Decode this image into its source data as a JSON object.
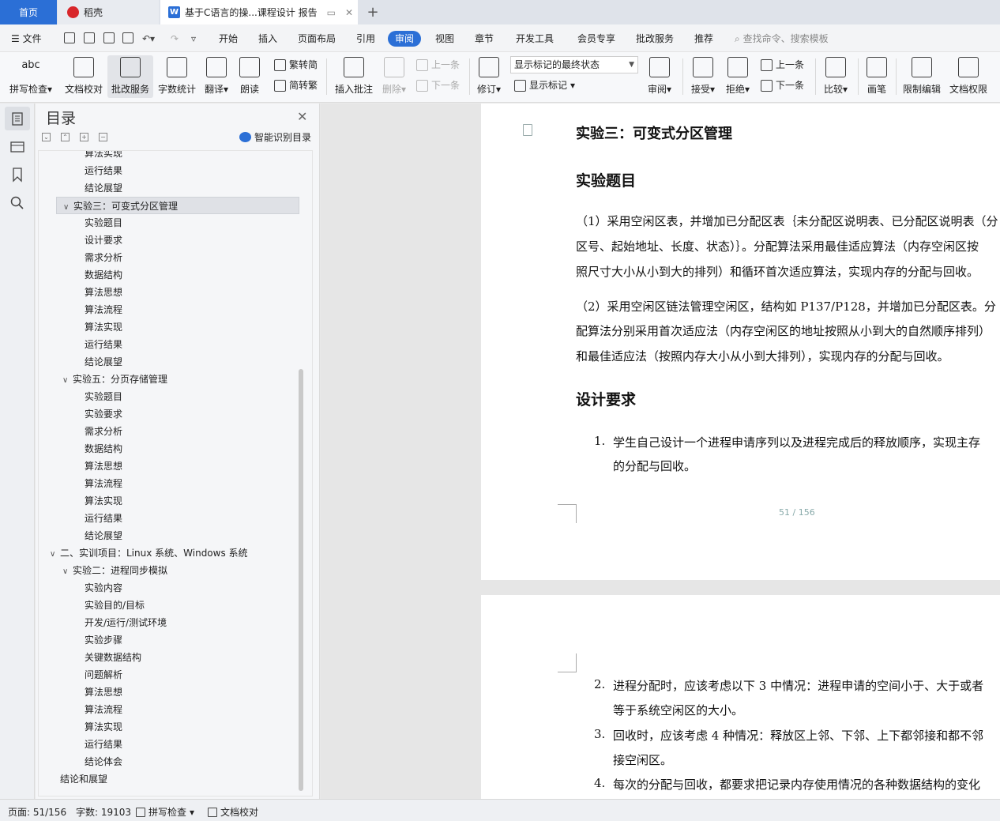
{
  "tabs": {
    "home": "首页",
    "daoke": "稻壳",
    "doc": "基于C语言的操...课程设计 报告",
    "add": "+"
  },
  "menu": {
    "file": "文件",
    "items": [
      "开始",
      "插入",
      "页面布局",
      "引用",
      "审阅",
      "视图",
      "章节",
      "开发工具",
      "会员专享",
      "批改服务",
      "推荐"
    ],
    "active": "审阅",
    "search_placeholder": "查找命令、搜索模板"
  },
  "ribbon": {
    "spellcheck": "拼写检查",
    "doc_proof": "文档校对",
    "correction_service": "批改服务",
    "word_count": "字数统计",
    "translate": "翻译",
    "read_aloud": "朗读",
    "trad_simp": "繁转简",
    "simp_trad": "简转繁",
    "insert_comment": "插入批注",
    "delete": "删除",
    "prev_comment": "上一条",
    "next_comment": "下一条",
    "track_changes": "修订",
    "markup_select": "显示标记的最终状态",
    "show_markup": "显示标记",
    "review": "审阅",
    "accept": "接受",
    "reject": "拒绝",
    "prev_change": "上一条",
    "next_change": "下一条",
    "compare": "比较",
    "pen": "画笔",
    "restrict_edit": "限制编辑",
    "doc_permission": "文档权限"
  },
  "toc": {
    "title": "目录",
    "smart": "智能识别目录",
    "items": [
      {
        "label": "算法实现",
        "level": 3
      },
      {
        "label": "运行结果",
        "level": 3
      },
      {
        "label": "结论展望",
        "level": 3
      },
      {
        "label": "实验三：可变式分区管理",
        "level": 2,
        "expanded": true,
        "selected": true
      },
      {
        "label": "实验题目",
        "level": 3
      },
      {
        "label": "设计要求",
        "level": 3
      },
      {
        "label": "需求分析",
        "level": 3
      },
      {
        "label": "数据结构",
        "level": 3
      },
      {
        "label": "算法思想",
        "level": 3
      },
      {
        "label": "算法流程",
        "level": 3
      },
      {
        "label": "算法实现",
        "level": 3
      },
      {
        "label": "运行结果",
        "level": 3
      },
      {
        "label": "结论展望",
        "level": 3
      },
      {
        "label": "实验五：分页存储管理",
        "level": 2,
        "expanded": true
      },
      {
        "label": "实验题目",
        "level": 3
      },
      {
        "label": "实验要求",
        "level": 3
      },
      {
        "label": "需求分析",
        "level": 3
      },
      {
        "label": "数据结构",
        "level": 3
      },
      {
        "label": "算法思想",
        "level": 3
      },
      {
        "label": "算法流程",
        "level": 3
      },
      {
        "label": "算法实现",
        "level": 3
      },
      {
        "label": "运行结果",
        "level": 3
      },
      {
        "label": "结论展望",
        "level": 3
      },
      {
        "label": "二、实训项目：Linux 系统、Windows 系统",
        "level": 1,
        "expanded": true
      },
      {
        "label": "实验二：进程同步模拟",
        "level": 2,
        "expanded": true
      },
      {
        "label": "实验内容",
        "level": 3
      },
      {
        "label": "实验目的/目标",
        "level": 3
      },
      {
        "label": "开发/运行/测试环境",
        "level": 3
      },
      {
        "label": "实验步骤",
        "level": 3
      },
      {
        "label": "关键数据结构",
        "level": 3
      },
      {
        "label": "问题解析",
        "level": 3
      },
      {
        "label": "算法思想",
        "level": 3
      },
      {
        "label": "算法流程",
        "level": 3
      },
      {
        "label": "算法实现",
        "level": 3
      },
      {
        "label": "运行结果",
        "level": 3
      },
      {
        "label": "结论体会",
        "level": 3
      },
      {
        "label": "结论和展望",
        "level": 1
      }
    ]
  },
  "document": {
    "top_heading": "实验三：可变式分区管理",
    "section1": "实验题目",
    "p1_lines": [
      "（1）采用空闲区表，并增加已分配区表｛未分配区说明表、已分配区说明表（分",
      "区号、起始地址、长度、状态）｝。分配算法采用最佳适应算法（内存空闲区按",
      "照尺寸大小从小到大的排列）和循环首次适应算法，实现内存的分配与回收。"
    ],
    "p2_lines": [
      "（2）采用空闲区链法管理空闲区，结构如 P137/P128，并增加已分配区表。分",
      "配算法分别采用首次适应法（内存空闲区的地址按照从小到大的自然顺序排列）",
      "和最佳适应法（按照内存大小从小到大排列），实现内存的分配与回收。"
    ],
    "section2": "设计要求",
    "list1_num": "1.",
    "list1_lines": [
      "学生自己设计一个进程申请序列以及进程完成后的释放顺序，实现主存",
      "的分配与回收。"
    ],
    "page_num": "51 / 156",
    "list2_num": "2.",
    "list2_lines": [
      "进程分配时，应该考虑以下 3 中情况：进程申请的空间小于、大于或者",
      "等于系统空闲区的大小。"
    ],
    "list3_num": "3.",
    "list3_lines": [
      "回收时，应该考虑 4 种情况：释放区上邻、下邻、上下都邻接和都不邻",
      "接空闲区。"
    ],
    "list4_num": "4.",
    "list4_lines": [
      "每次的分配与回收，都要求把记录内存使用情况的各种数据结构的变化"
    ]
  },
  "status": {
    "page": "页面: 51/156",
    "words": "字数: 19103",
    "spell": "拼写检查",
    "proof": "文档校对"
  },
  "colors": {
    "accent": "#2b6fd6"
  }
}
